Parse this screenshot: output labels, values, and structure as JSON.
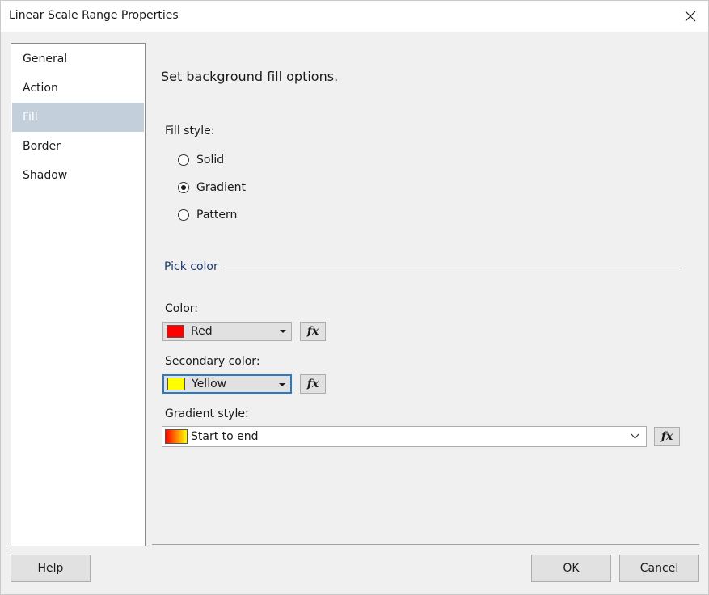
{
  "window": {
    "title": "Linear Scale Range Properties",
    "close_icon": "close-icon"
  },
  "sidebar": {
    "items": [
      {
        "label": "General",
        "selected": false
      },
      {
        "label": "Action",
        "selected": false
      },
      {
        "label": "Fill",
        "selected": true
      },
      {
        "label": "Border",
        "selected": false
      },
      {
        "label": "Shadow",
        "selected": false
      }
    ]
  },
  "main": {
    "heading": "Set background fill options.",
    "fill_style": {
      "label": "Fill style:",
      "options": [
        {
          "label": "Solid",
          "checked": false
        },
        {
          "label": "Gradient",
          "checked": true
        },
        {
          "label": "Pattern",
          "checked": false
        }
      ]
    },
    "pick_color": {
      "group_title": "Pick color",
      "color": {
        "label": "Color:",
        "value": "Red",
        "swatch": "#ff0000",
        "fx_label": "fx"
      },
      "secondary_color": {
        "label": "Secondary color:",
        "value": "Yellow",
        "swatch": "#ffff00",
        "fx_label": "fx"
      },
      "gradient_style": {
        "label": "Gradient style:",
        "value": "Start to end",
        "fx_label": "fx"
      }
    }
  },
  "footer": {
    "help_label": "Help",
    "ok_label": "OK",
    "cancel_label": "Cancel"
  },
  "colors": {
    "selection": "#c3cfda",
    "group_title": "#1c3a6e",
    "focus": "#2b79c4"
  }
}
